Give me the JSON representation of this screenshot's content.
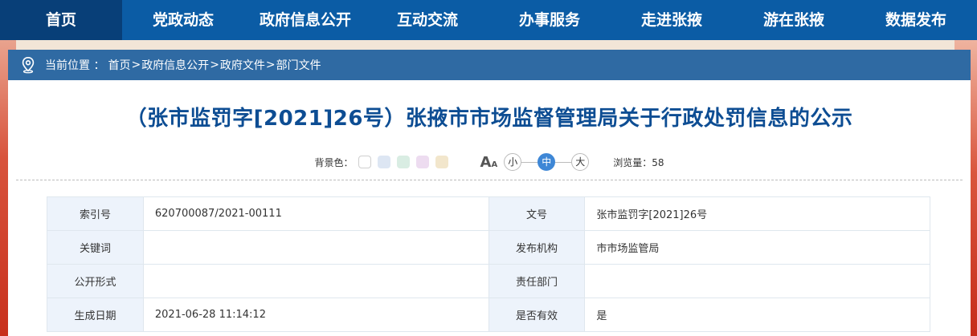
{
  "nav": {
    "items": [
      {
        "label": "首页"
      },
      {
        "label": "党政动态"
      },
      {
        "label": "政府信息公开"
      },
      {
        "label": "互动交流"
      },
      {
        "label": "办事服务"
      },
      {
        "label": "走进张掖"
      },
      {
        "label": "游在张掖"
      },
      {
        "label": "数据发布"
      }
    ]
  },
  "breadcrumb": {
    "prefix": "当前位置 ：",
    "items": [
      "首页",
      "政府信息公开",
      "政府文件",
      "部门文件"
    ],
    "separator": ">"
  },
  "article": {
    "title": "（张市监罚字[2021]26号）张掖市市场监督管理局关于行政处罚信息的公示"
  },
  "tools": {
    "bg_label": "背景色：",
    "bg_colors": [
      "#ffffff",
      "#dde6f3",
      "#d9ede3",
      "#eddcf0",
      "#f2e6cc"
    ],
    "font_icon_big": "A",
    "font_icon_small": "A",
    "size_small": "小",
    "size_mid": "中",
    "size_large": "大",
    "views_label": "浏览量：",
    "views_count": "58"
  },
  "meta": {
    "rows": [
      {
        "k1": "索引号",
        "v1": "620700087/2021-00111",
        "k2": "文号",
        "v2": "张市监罚字[2021]26号"
      },
      {
        "k1": "关键词",
        "v1": "",
        "k2": "发布机构",
        "v2": "市市场监管局"
      },
      {
        "k1": "公开形式",
        "v1": "",
        "k2": "责任部门",
        "v2": ""
      },
      {
        "k1": "生成日期",
        "v1": "2021-06-28 11:14:12",
        "k2": "是否有效",
        "v2": "是"
      }
    ]
  }
}
